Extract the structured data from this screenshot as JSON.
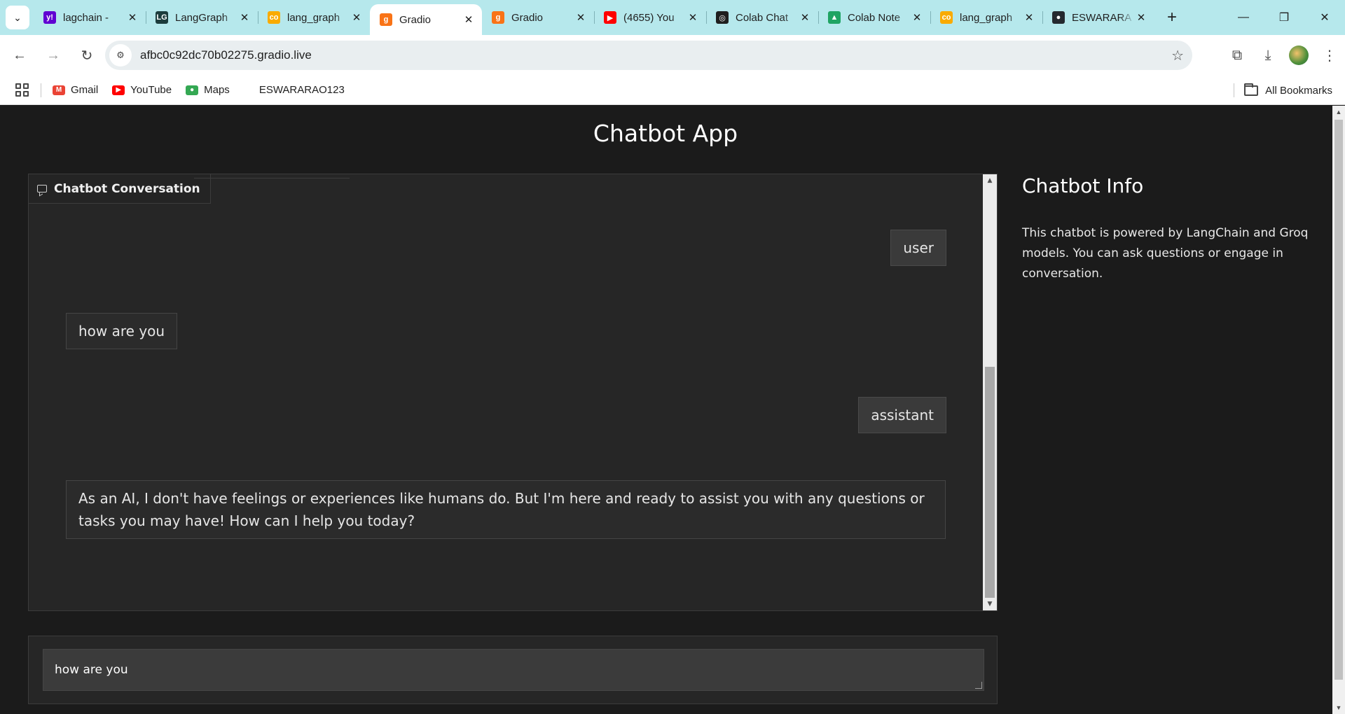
{
  "browser": {
    "tab_search_icon": "chevron-down-icon",
    "tabs": [
      {
        "title": "lagchain -",
        "favicon": "yahoo-icon",
        "favicon_color": "#6001d2",
        "favicon_glyph": "y!",
        "active": false
      },
      {
        "title": "LangGraph",
        "favicon": "langgraph-icon",
        "favicon_color": "#1c3c3c",
        "favicon_glyph": "LG",
        "active": false
      },
      {
        "title": "lang_graph",
        "favicon": "colab-icon",
        "favicon_color": "#f9ab00",
        "favicon_glyph": "co",
        "active": false
      },
      {
        "title": "Gradio",
        "favicon": "gradio-icon",
        "favicon_color": "#f97316",
        "favicon_glyph": "g",
        "active": true
      },
      {
        "title": "Gradio",
        "favicon": "gradio-icon",
        "favicon_color": "#f97316",
        "favicon_glyph": "g",
        "active": false
      },
      {
        "title": "(4655) You",
        "favicon": "youtube-icon",
        "favicon_color": "#ff0000",
        "favicon_glyph": "▶",
        "active": false
      },
      {
        "title": "Colab Chat",
        "favicon": "openai-icon",
        "favicon_color": "#1f1f1f",
        "favicon_glyph": "◎",
        "active": false
      },
      {
        "title": "Colab Note",
        "favicon": "google-drive-icon",
        "favicon_color": "#1fa463",
        "favicon_glyph": "▲",
        "active": false
      },
      {
        "title": "lang_graph",
        "favicon": "colab-icon",
        "favicon_color": "#f9ab00",
        "favicon_glyph": "co",
        "active": false
      },
      {
        "title": "ESWARARA",
        "favicon": "github-icon",
        "favicon_color": "#24292f",
        "favicon_glyph": "●",
        "active": false
      }
    ],
    "new_tab_label": "+",
    "window_controls": {
      "minimize": "—",
      "restore": "❐",
      "close": "✕"
    },
    "nav": {
      "back": "←",
      "forward": "→",
      "reload": "↻"
    },
    "url": "afbc0c92dc70b02275.gradio.live",
    "bookmarks": [
      {
        "label": "Gmail",
        "icon": "gmail-icon",
        "color": "#ea4335",
        "glyph": "M"
      },
      {
        "label": "YouTube",
        "icon": "youtube-icon",
        "color": "#ff0000",
        "glyph": "▶"
      },
      {
        "label": "Maps",
        "icon": "maps-pin-icon",
        "color": "#34a853",
        "glyph": "●"
      },
      {
        "label": "ESWARARAO123",
        "icon": "",
        "color": "",
        "glyph": ""
      }
    ],
    "all_bookmarks_label": "All Bookmarks"
  },
  "app": {
    "title": "Chatbot App",
    "chat_label": "Chatbot Conversation",
    "messages": [
      {
        "text": "user",
        "kind": "role"
      },
      {
        "text": "how are you",
        "kind": "message"
      },
      {
        "text": "assistant",
        "kind": "role"
      },
      {
        "text": "As an AI, I don't have feelings or experiences like humans do. But I'm here and ready to assist you with any questions or tasks you may have! How can I help you today?",
        "kind": "message"
      }
    ],
    "info_title": "Chatbot Info",
    "info_text": "This chatbot is powered by LangChain and Groq models. You can ask questions or engage in conversation.",
    "input_value": "how are you"
  }
}
